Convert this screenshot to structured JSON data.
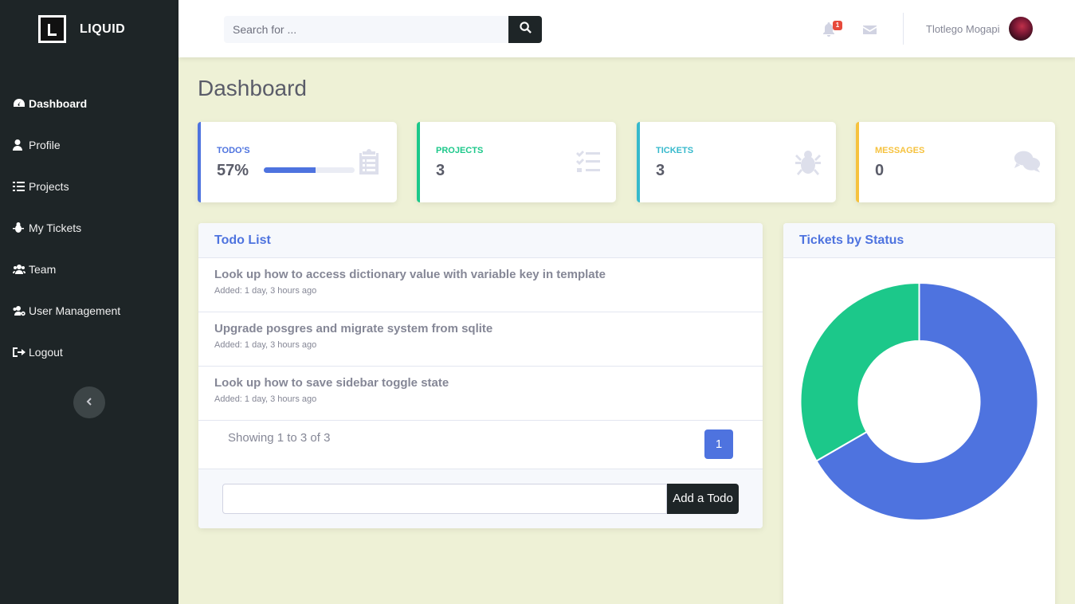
{
  "brand": {
    "name": "LIQUID"
  },
  "sidebar": {
    "items": [
      {
        "label": "Dashboard",
        "icon": "tachometer-icon",
        "active": true
      },
      {
        "label": "Profile",
        "icon": "user-icon"
      },
      {
        "label": "Projects",
        "icon": "tasks-icon"
      },
      {
        "label": "My Tickets",
        "icon": "bug-icon"
      },
      {
        "label": "Team",
        "icon": "users-icon"
      },
      {
        "label": "User Management",
        "icon": "users-cog-icon"
      },
      {
        "label": "Logout",
        "icon": "sign-out-icon"
      }
    ],
    "toggle_icon": "chevron-left-icon"
  },
  "topbar": {
    "search_placeholder": "Search for ...",
    "notifications_count": "1",
    "username": "Tlotlego Mogapi"
  },
  "page": {
    "title": "Dashboard"
  },
  "cards": [
    {
      "label": "TODO'S",
      "value": "57%",
      "progress": 0.57,
      "color": "#4e73df",
      "icon": "clipboard-list-icon"
    },
    {
      "label": "PROJECTS",
      "value": "3",
      "color": "#1cc88a",
      "icon": "tasks-icon"
    },
    {
      "label": "TICKETS",
      "value": "3",
      "color": "#36b9cc",
      "icon": "bug-icon"
    },
    {
      "label": "MESSAGES",
      "value": "0",
      "color": "#f6c23e",
      "icon": "comments-icon"
    }
  ],
  "todo": {
    "title": "Todo List",
    "items": [
      {
        "title": "Look up how to access dictionary value with variable key in template",
        "meta": "Added: 1 day, 3 hours ago"
      },
      {
        "title": "Upgrade posgres and migrate system from sqlite",
        "meta": "Added: 1 day, 3 hours ago"
      },
      {
        "title": "Look up how to save sidebar toggle state",
        "meta": "Added: 1 day, 3 hours ago"
      }
    ],
    "pager_info": "Showing 1 to 3 of 3",
    "current_page": "1",
    "add_button": "Add a Todo"
  },
  "tickets": {
    "title": "Tickets by Status"
  },
  "chart_data": {
    "type": "pie",
    "values": [
      2,
      1
    ],
    "colors": [
      "#4e73df",
      "#1cc88a"
    ]
  }
}
